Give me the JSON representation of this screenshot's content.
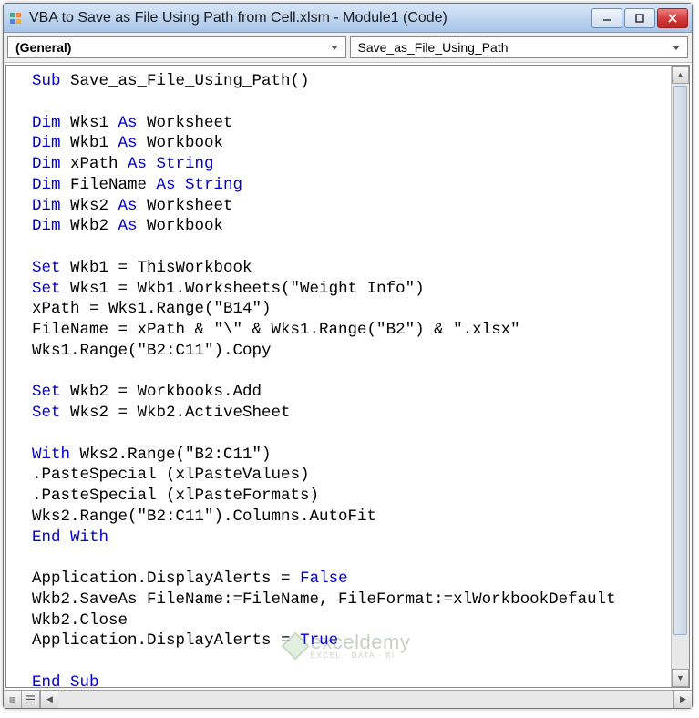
{
  "window": {
    "title": "VBA to Save as File Using Path from Cell.xlsm - Module1 (Code)"
  },
  "dropdowns": {
    "object": "(General)",
    "procedure": "Save_as_File_Using_Path"
  },
  "code": {
    "tokens": [
      [
        "kw",
        "Sub"
      ],
      [
        "",
        " Save_as_File_Using_Path()"
      ],
      [
        "br",
        ""
      ],
      [
        "br",
        ""
      ],
      [
        "kw",
        "Dim"
      ],
      [
        "",
        " Wks1 "
      ],
      [
        "kw",
        "As"
      ],
      [
        "",
        " Worksheet"
      ],
      [
        "br",
        ""
      ],
      [
        "kw",
        "Dim"
      ],
      [
        "",
        " Wkb1 "
      ],
      [
        "kw",
        "As"
      ],
      [
        "",
        " Workbook"
      ],
      [
        "br",
        ""
      ],
      [
        "kw",
        "Dim"
      ],
      [
        "",
        " xPath "
      ],
      [
        "kw",
        "As String"
      ],
      [
        "br",
        ""
      ],
      [
        "kw",
        "Dim"
      ],
      [
        "",
        " FileName "
      ],
      [
        "kw",
        "As String"
      ],
      [
        "br",
        ""
      ],
      [
        "kw",
        "Dim"
      ],
      [
        "",
        " Wks2 "
      ],
      [
        "kw",
        "As"
      ],
      [
        "",
        " Worksheet"
      ],
      [
        "br",
        ""
      ],
      [
        "kw",
        "Dim"
      ],
      [
        "",
        " Wkb2 "
      ],
      [
        "kw",
        "As"
      ],
      [
        "",
        " Workbook"
      ],
      [
        "br",
        ""
      ],
      [
        "br",
        ""
      ],
      [
        "kw",
        "Set"
      ],
      [
        "",
        " Wkb1 = ThisWorkbook"
      ],
      [
        "br",
        ""
      ],
      [
        "kw",
        "Set"
      ],
      [
        "",
        " Wks1 = Wkb1.Worksheets(\"Weight Info\")"
      ],
      [
        "br",
        ""
      ],
      [
        "",
        "xPath = Wks1.Range(\"B14\")"
      ],
      [
        "br",
        ""
      ],
      [
        "",
        "FileName = xPath & \"\\\" & Wks1.Range(\"B2\") & \".xlsx\""
      ],
      [
        "br",
        ""
      ],
      [
        "",
        "Wks1.Range(\"B2:C11\").Copy"
      ],
      [
        "br",
        ""
      ],
      [
        "br",
        ""
      ],
      [
        "kw",
        "Set"
      ],
      [
        "",
        " Wkb2 = Workbooks.Add"
      ],
      [
        "br",
        ""
      ],
      [
        "kw",
        "Set"
      ],
      [
        "",
        " Wks2 = Wkb2.ActiveSheet"
      ],
      [
        "br",
        ""
      ],
      [
        "br",
        ""
      ],
      [
        "kw",
        "With"
      ],
      [
        "",
        " Wks2.Range(\"B2:C11\")"
      ],
      [
        "br",
        ""
      ],
      [
        "",
        ".PasteSpecial (xlPasteValues)"
      ],
      [
        "br",
        ""
      ],
      [
        "",
        ".PasteSpecial (xlPasteFormats)"
      ],
      [
        "br",
        ""
      ],
      [
        "",
        "Wks2.Range(\"B2:C11\").Columns.AutoFit"
      ],
      [
        "br",
        ""
      ],
      [
        "kw",
        "End With"
      ],
      [
        "br",
        ""
      ],
      [
        "br",
        ""
      ],
      [
        "",
        "Application.DisplayAlerts = "
      ],
      [
        "kw",
        "False"
      ],
      [
        "br",
        ""
      ],
      [
        "",
        "Wkb2.SaveAs FileName:=FileName, FileFormat:=xlWorkbookDefault"
      ],
      [
        "br",
        ""
      ],
      [
        "",
        "Wkb2.Close"
      ],
      [
        "br",
        ""
      ],
      [
        "",
        "Application.DisplayAlerts = "
      ],
      [
        "kw",
        "True"
      ],
      [
        "br",
        ""
      ],
      [
        "br",
        ""
      ],
      [
        "kw",
        "End Sub"
      ]
    ]
  },
  "watermark": {
    "name": "exceldemy",
    "tagline": "EXCEL · DATA · BI"
  }
}
